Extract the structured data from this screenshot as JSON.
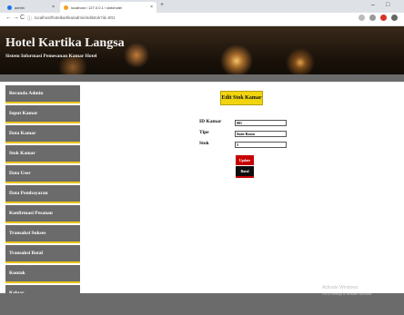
{
  "browser": {
    "tabs": [
      {
        "label": "admin",
        "favicon_color": "#1a73e8"
      },
      {
        "label": "localhost / 127.0.0.1 / sisfohotel",
        "favicon_color": "#f4a020"
      }
    ],
    "new_tab": "+",
    "url": "localhost/hotelkartika/admin/editstok?id=001",
    "nav": {
      "back": "←",
      "forward": "→",
      "reload": "C",
      "info": "ⓘ"
    },
    "window": {
      "minimize": "–",
      "maximize": "□"
    }
  },
  "header": {
    "title": "Hotel Kartika Langsa",
    "subtitle": "Sistem Informasi Pemesanan Kamar Hotel"
  },
  "sidebar": {
    "items": [
      {
        "label": "Beranda Admin"
      },
      {
        "label": "Input Kamar"
      },
      {
        "label": "Data Kamar"
      },
      {
        "label": "Stok Kamar"
      },
      {
        "label": "Data User"
      },
      {
        "label": "Data Pembayaran"
      },
      {
        "label": "Konfirmasi Pesanan"
      },
      {
        "label": "Transaksi Sukses"
      },
      {
        "label": "Transaksi Batal"
      },
      {
        "label": "Kontak"
      },
      {
        "label": "Keluar"
      }
    ]
  },
  "form": {
    "title": "Edit Stok Kamar",
    "fields": [
      {
        "label": "ID Kamar",
        "value": "001"
      },
      {
        "label": "Tipe",
        "value": "Suite Room"
      },
      {
        "label": "Stok",
        "value": "5"
      }
    ],
    "update_label": "Update",
    "batal_label": "Batal"
  },
  "watermark": {
    "line1": "Activate Windows",
    "line2": "Go to Settings to activate Windows."
  },
  "colors": {
    "accent": "#f2d40e",
    "sidebar_bg": "#6b6b6b",
    "update": "#c70000",
    "batal": "#0d0d0d"
  }
}
